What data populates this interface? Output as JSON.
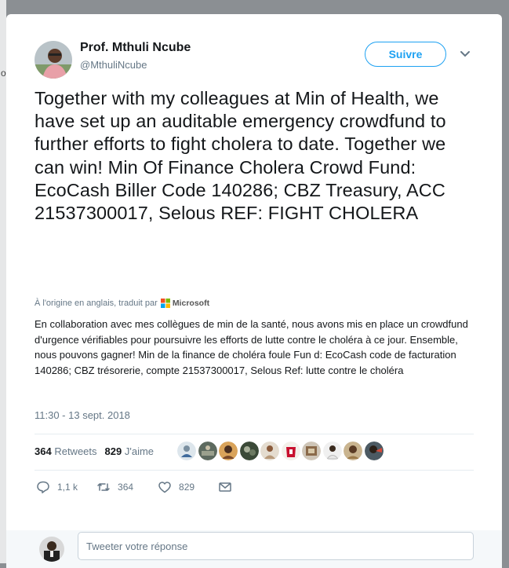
{
  "backdrop": {
    "hint": "o"
  },
  "author": {
    "name": "Prof. Mthuli Ncube",
    "handle": "@MthuliNcube"
  },
  "follow": {
    "label": "Suivre"
  },
  "tweet": {
    "text": "Together with my colleagues at Min of Health, we have set up an auditable emergency crowdfund to further efforts to fight cholera to date. Together we can win! Min Of Finance Cholera Crowd Fund: EcoCash Biller Code 140286; CBZ Treasury, ACC 21537300017, Selous REF: FIGHT CHOLERA"
  },
  "translation": {
    "meta": "À l'origine en anglais, traduit par",
    "provider": "Microsoft",
    "text": "En collaboration avec mes collègues de min de la santé, nous avons mis en place un crowdfund d'urgence vérifiables pour poursuivre les efforts de lutte contre le choléra à ce jour. Ensemble, nous pouvons gagner! Min de la finance de choléra foule Fun d: EcoCash code de facturation 140286; CBZ trésorerie, compte 21537300017, Selous Ref: lutte contre le choléra"
  },
  "timestamp": "11:30 - 13 sept. 2018",
  "stats": {
    "retweets": "364",
    "retweets_label": "Retweets",
    "likes": "829",
    "likes_label": "J'aime"
  },
  "liker_avatars": [
    "avatar-1",
    "avatar-2",
    "avatar-3",
    "avatar-4",
    "avatar-5",
    "avatar-6",
    "avatar-7",
    "avatar-8",
    "avatar-9",
    "avatar-10"
  ],
  "actions": {
    "reply_count": "1,1 k",
    "retweet_count": "364",
    "like_count": "829"
  },
  "reply": {
    "placeholder": "Tweeter votre réponse"
  },
  "colors": {
    "accent": "#1da1f2",
    "text": "#14171a",
    "secondary": "#657786"
  }
}
